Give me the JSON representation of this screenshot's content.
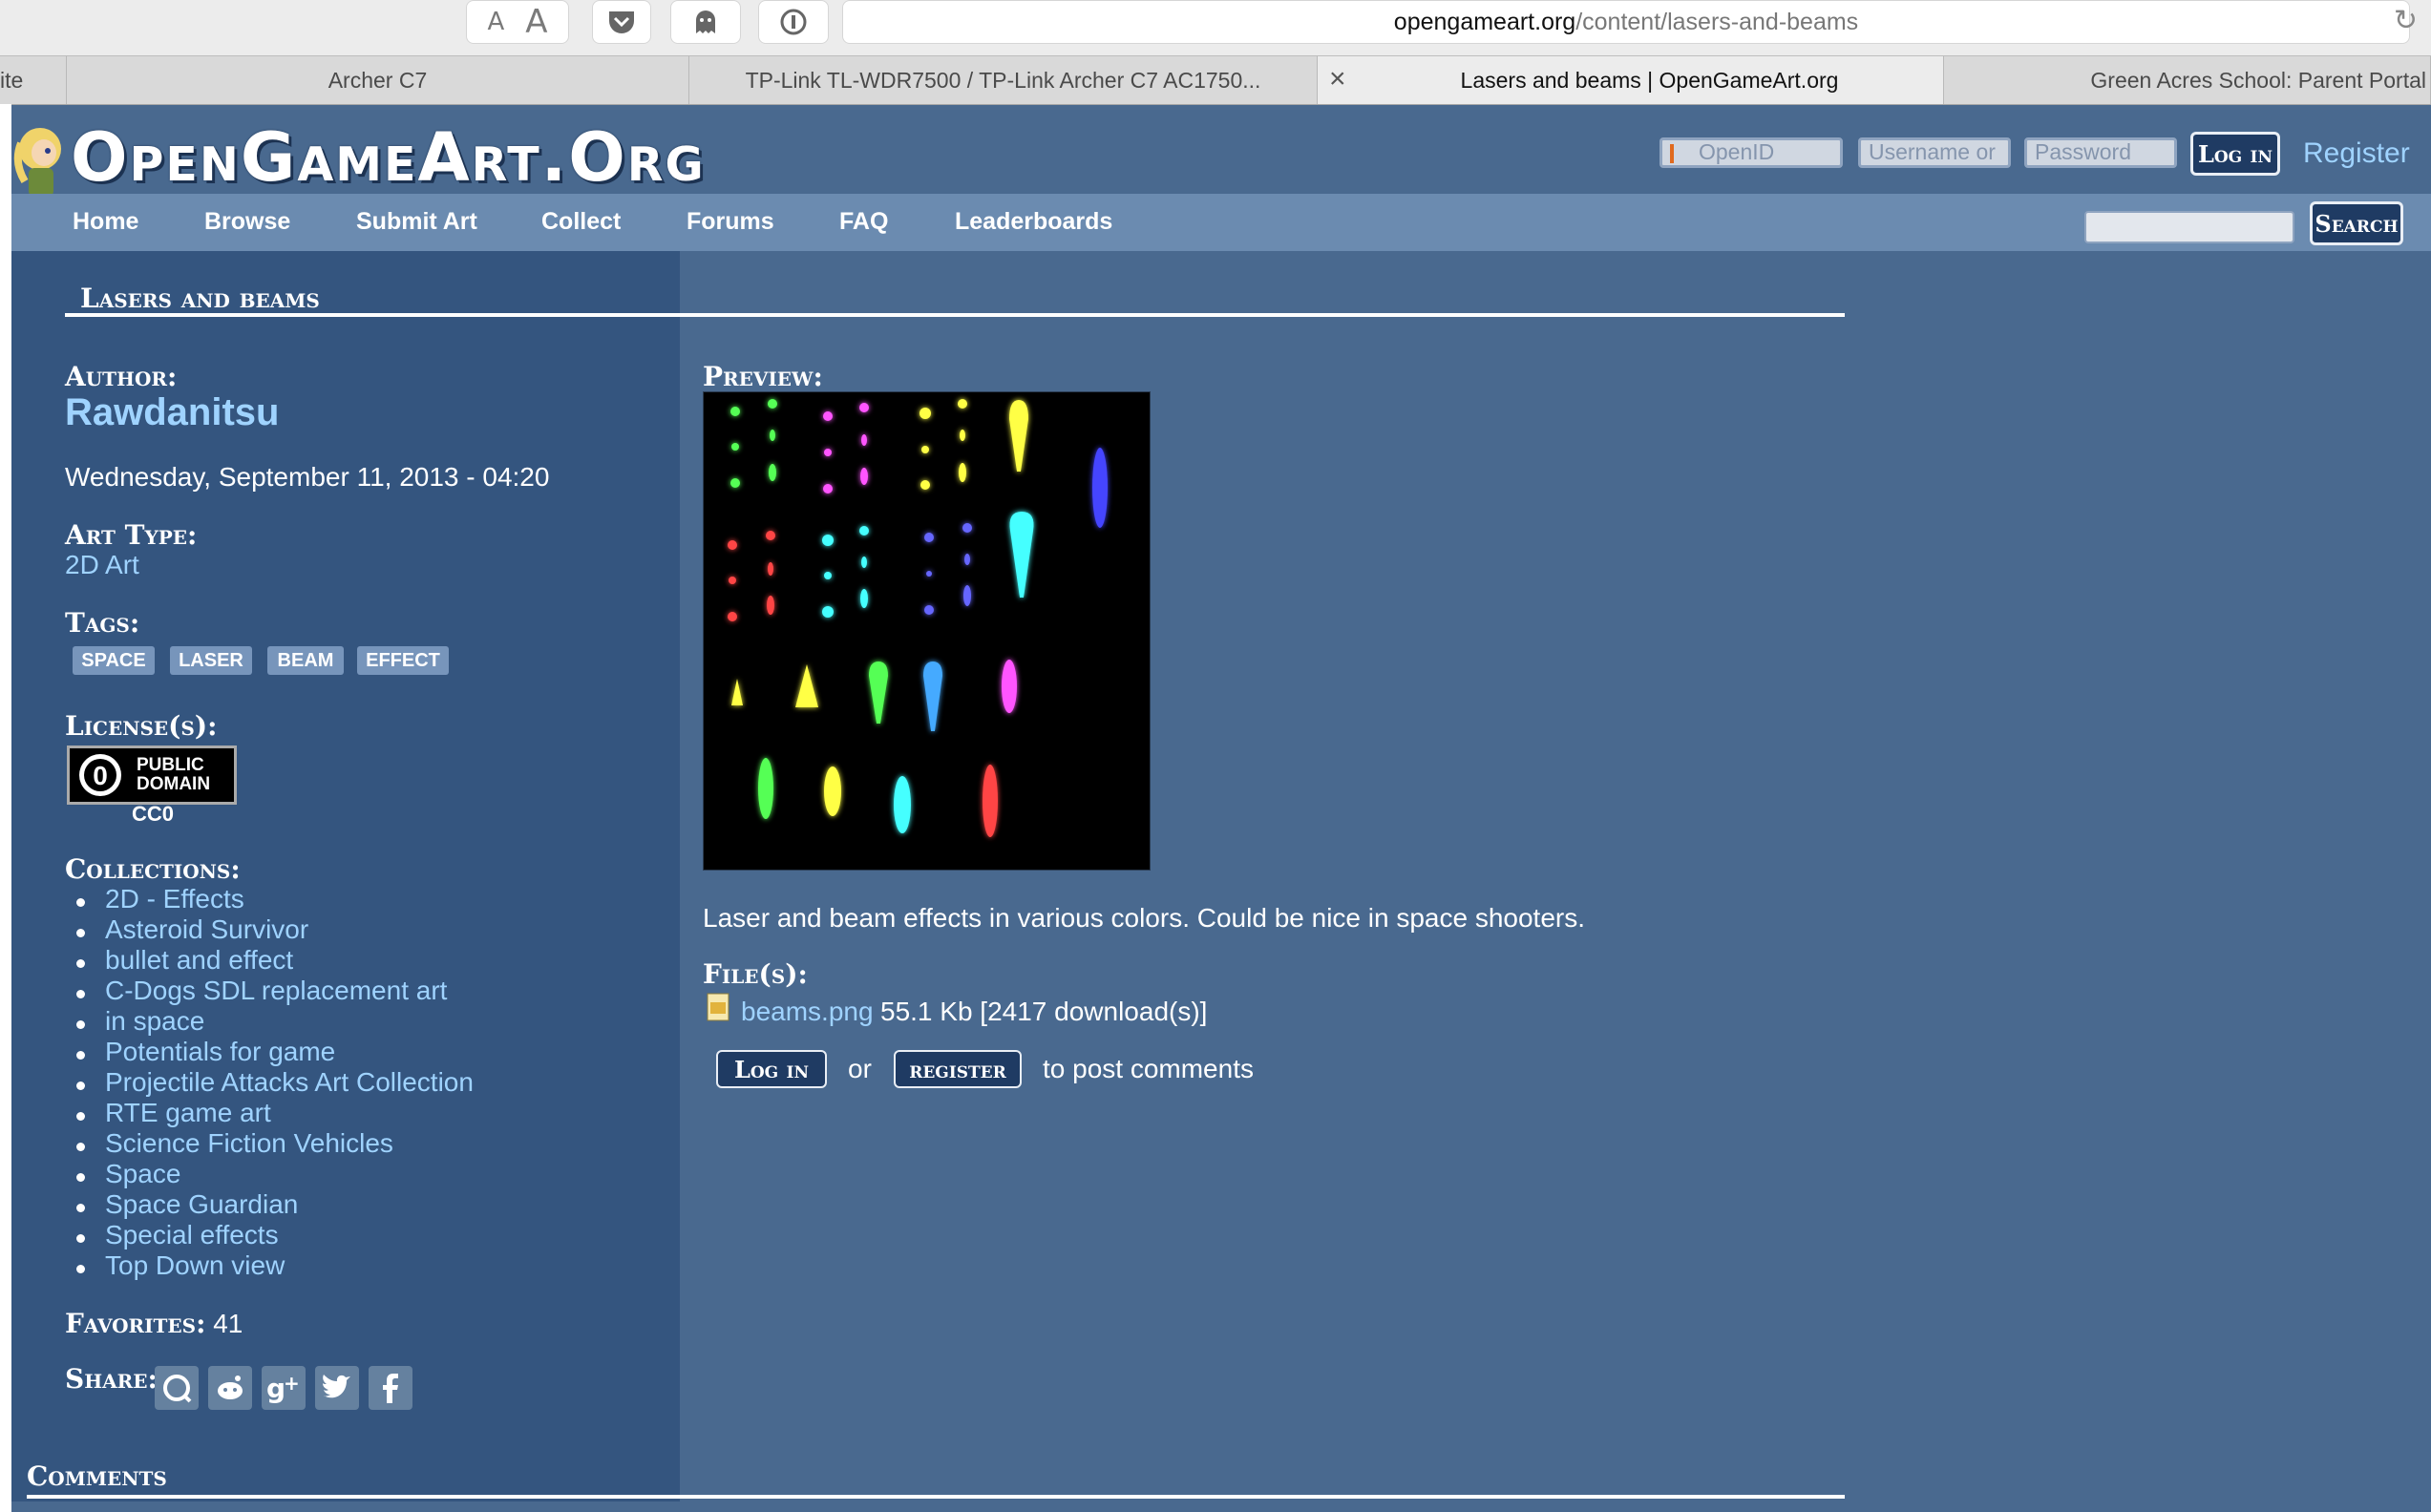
{
  "browser": {
    "reader_small": "A",
    "reader_large": "A",
    "url_host": "opengameart.org",
    "url_path": "/content/lasers-and-beams",
    "tabs": [
      {
        "label": "ite"
      },
      {
        "label": "Archer C7"
      },
      {
        "label": "TP-Link TL-WDR7500 / TP-Link Archer C7 AC1750..."
      },
      {
        "label": "Lasers and beams | OpenGameArt.org"
      },
      {
        "label": "Green Acres School: Parent Portal"
      }
    ],
    "tab_close": "×"
  },
  "site": {
    "logo": "OpenGameArt.Org",
    "login": {
      "openid_placeholder": "OpenID",
      "username_placeholder": "Username or",
      "password_placeholder": "Password",
      "login_label": "Log in",
      "register_label": "Register"
    },
    "nav": [
      "Home",
      "Browse",
      "Submit Art",
      "Collect",
      "Forums",
      "FAQ",
      "Leaderboards"
    ],
    "search_label": "Search"
  },
  "page": {
    "title": "Lasers and beams",
    "author_label": "Author:",
    "author": "Rawdanitsu",
    "date": "Wednesday, September 11, 2013 - 04:20",
    "art_type_label": "Art Type:",
    "art_type": "2D Art",
    "tags_label": "Tags:",
    "tags": [
      "SPACE",
      "LASER",
      "BEAM",
      "EFFECT"
    ],
    "license_label": "License(s):",
    "license_badge_line1": "PUBLIC",
    "license_badge_line2": "DOMAIN",
    "license_name": "CC0",
    "collections_label": "Collections:",
    "collections": [
      "2D - Effects",
      "Asteroid Survivor",
      "bullet and effect",
      "C-Dogs SDL replacement art",
      "in space",
      "Potentials for game",
      "Projectile Attacks Art Collection",
      "RTE game art",
      "Science Fiction Vehicles",
      "Space",
      "Space Guardian",
      "Special effects",
      "Top Down view"
    ],
    "favorites_label": "Favorites:",
    "favorites_count": "41",
    "share_label": "Share:",
    "share_icons": [
      "stumbleupon-icon",
      "reddit-icon",
      "google-plus-icon",
      "twitter-icon",
      "facebook-icon"
    ],
    "preview_label": "Preview:",
    "description": "Laser and beam effects in various colors. Could be nice in space shooters.",
    "files_label": "File(s):",
    "file_name": "beams.png",
    "file_info": "55.1 Kb [2417 download(s)]",
    "comment_login": "Log in",
    "comment_or": "or",
    "comment_register": "register",
    "comment_suffix": "to post comments",
    "comments_heading": "Comments"
  }
}
